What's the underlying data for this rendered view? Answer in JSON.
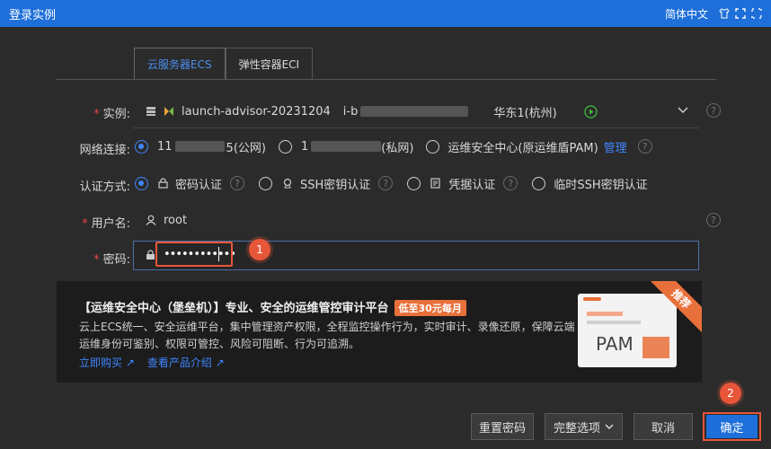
{
  "titlebar": {
    "title": "登录实例",
    "language": "简体中文"
  },
  "tabs": [
    {
      "label": "云服务器ECS",
      "active": true
    },
    {
      "label": "弹性容器ECI",
      "active": false
    }
  ],
  "form": {
    "instance": {
      "label": "实例:",
      "name": "launch-advisor-20231204",
      "id_prefix": "i-b",
      "region": "华东1(杭州)"
    },
    "network": {
      "label": "网络连接:",
      "public_prefix": "11",
      "public_suffix": "5(公网)",
      "private_prefix": "1",
      "private_suffix": "(私网)",
      "bastion": "运维安全中心(原运维盾PAM)",
      "manage": "管理"
    },
    "auth": {
      "label": "认证方式:",
      "options": [
        "密码认证",
        "SSH密钥认证",
        "凭据认证",
        "临时SSH密钥认证"
      ]
    },
    "username": {
      "label": "用户名:",
      "value": "root"
    },
    "password": {
      "label": "密码:",
      "value": "••••••••••••"
    }
  },
  "banner": {
    "title": "【运维安全中心（堡垒机）】专业、安全的运维管控审计平台",
    "promo": "低至30元每月",
    "desc": "云上ECS统一、安全运维平台，集中管理资产权限，全程监控操作行为，实时审计、录像还原，保障云端运维身份可鉴别、权限可管控、风险可阻断、行为可追溯。",
    "link_buy": "立即购买",
    "link_intro": "查看产品介绍",
    "ribbon": "推荐",
    "illustration_text": "PAM"
  },
  "footer": {
    "reset": "重置密码",
    "options": "完整选项",
    "cancel": "取消",
    "ok": "确定"
  },
  "steps": {
    "step1": "1",
    "step2": "2"
  },
  "colors": {
    "accent": "#1e6fd9",
    "highlight": "#e8563a",
    "promo": "#e8703a"
  }
}
